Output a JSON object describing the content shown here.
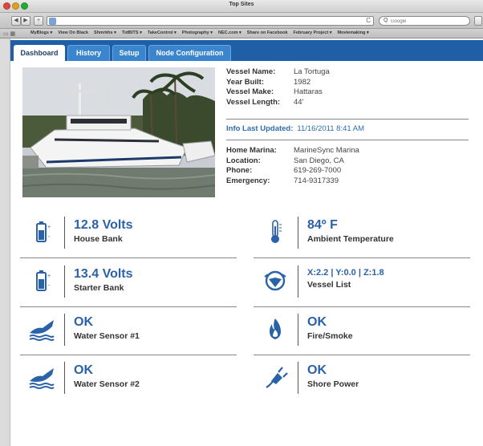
{
  "window": {
    "title": "Top Sites"
  },
  "toolbar": {
    "search_placeholder": "Google",
    "search_glyph": "Q",
    "back": "◀",
    "forward": "▶",
    "add": "+",
    "reload": "C"
  },
  "bookmarks": [
    "MyBlogs ▾",
    "View On Black",
    "Shmrkhs ▾",
    "TidBITS ▾",
    "TakeControl ▾",
    "Photography ▾",
    "NEC.com ▾",
    "Share on Facebook",
    "February Project ▾",
    "Moviemaking ▾"
  ],
  "tabs": [
    {
      "label": "Dashboard",
      "active": true
    },
    {
      "label": "History"
    },
    {
      "label": "Setup"
    },
    {
      "label": "Node Configuration"
    }
  ],
  "vessel": {
    "name_label": "Vessel Name:",
    "name": "La Tortuga",
    "year_label": "Year Built:",
    "year": "1982",
    "make_label": "Vessel Make:",
    "make": "Hattaras",
    "length_label": "Vessel Length:",
    "length": "44'"
  },
  "updated": {
    "label": "Info Last Updated:",
    "value": "11/16/2011 8:41 AM"
  },
  "contact": {
    "marina_label": "Home Marina:",
    "marina": "MarineSync Marina",
    "location_label": "Location:",
    "location": "San Diego, CA",
    "phone_label": "Phone:",
    "phone": "619-269-7000",
    "emergency_label": "Emergency:",
    "emergency": "714-9317339"
  },
  "status": {
    "house_bank": {
      "value": "12.8 Volts",
      "label": "House Bank"
    },
    "ambient": {
      "value": "84º F",
      "label": "Ambient Temperature"
    },
    "starter_bank": {
      "value": "13.4 Volts",
      "label": "Starter Bank"
    },
    "vessel_list": {
      "value": "X:2.2 | Y:0.0 | Z:1.8",
      "label": "Vessel List"
    },
    "water1": {
      "value": "OK",
      "label": "Water Sensor #1"
    },
    "fire": {
      "value": "OK",
      "label": "Fire/Smoke"
    },
    "water2": {
      "value": "OK",
      "label": "Water Sensor #2"
    },
    "shore": {
      "value": "OK",
      "label": "Shore Power"
    }
  },
  "colors": {
    "accent": "#2a62a8",
    "tabbar": "#1f5fa6",
    "tab": "#3b85cf"
  }
}
